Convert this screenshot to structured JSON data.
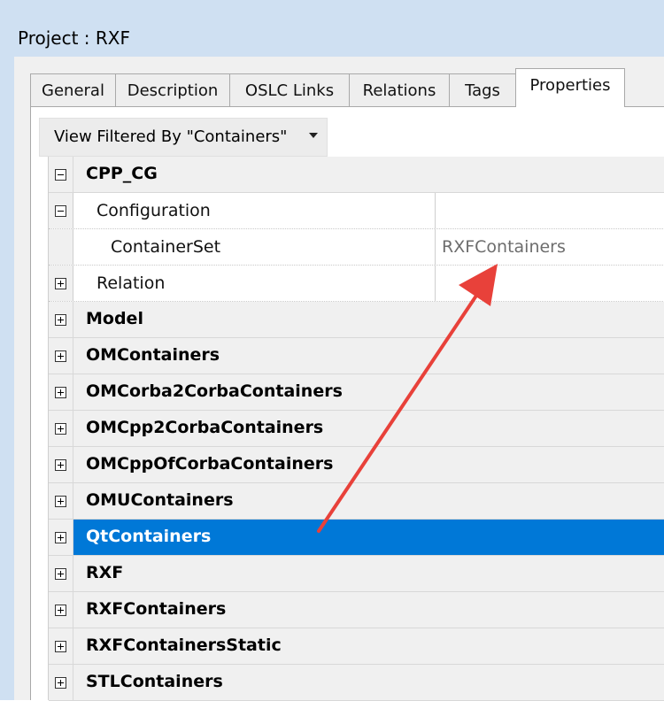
{
  "window": {
    "title": "Project : RXF"
  },
  "tabs": [
    {
      "label": "General",
      "active": false
    },
    {
      "label": "Description",
      "active": false
    },
    {
      "label": "OSLC Links",
      "active": false
    },
    {
      "label": "Relations",
      "active": false
    },
    {
      "label": "Tags",
      "active": false
    },
    {
      "label": "Properties",
      "active": true
    }
  ],
  "filter": {
    "label": "View Filtered By \"Containers\""
  },
  "grid": {
    "rows": [
      {
        "kind": "category",
        "label": "CPP_CG",
        "expanded": true,
        "selected": false
      },
      {
        "kind": "group",
        "label": "Configuration",
        "expanded": true
      },
      {
        "kind": "property",
        "label": "ContainerSet",
        "value": "RXFContainers"
      },
      {
        "kind": "group",
        "label": "Relation",
        "expanded": false
      },
      {
        "kind": "category",
        "label": "Model",
        "expanded": false,
        "selected": false
      },
      {
        "kind": "category",
        "label": "OMContainers",
        "expanded": false,
        "selected": false
      },
      {
        "kind": "category",
        "label": "OMCorba2CorbaContainers",
        "expanded": false,
        "selected": false
      },
      {
        "kind": "category",
        "label": "OMCpp2CorbaContainers",
        "expanded": false,
        "selected": false
      },
      {
        "kind": "category",
        "label": "OMCppOfCorbaContainers",
        "expanded": false,
        "selected": false
      },
      {
        "kind": "category",
        "label": "OMUContainers",
        "expanded": false,
        "selected": false
      },
      {
        "kind": "category",
        "label": "QtContainers",
        "expanded": false,
        "selected": true
      },
      {
        "kind": "category",
        "label": "RXF",
        "expanded": false,
        "selected": false
      },
      {
        "kind": "category",
        "label": "RXFContainers",
        "expanded": false,
        "selected": false
      },
      {
        "kind": "category",
        "label": "RXFContainersStatic",
        "expanded": false,
        "selected": false
      },
      {
        "kind": "category",
        "label": "STLContainers",
        "expanded": false,
        "selected": false
      }
    ]
  },
  "colors": {
    "selection": "#0078d7",
    "annotation_arrow": "#e8413a",
    "value_text": "#6d6d6d"
  }
}
